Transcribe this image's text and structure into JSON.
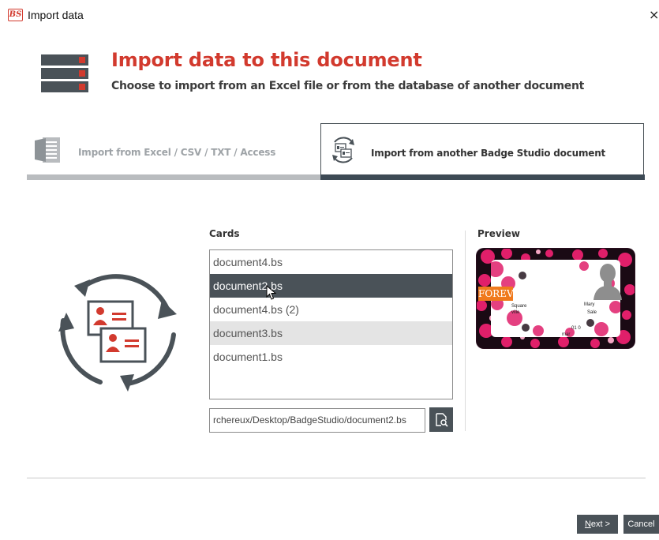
{
  "window": {
    "app_logo": "BS",
    "title": "Import data",
    "close_glyph": "×"
  },
  "header": {
    "icon": "server-stack-icon",
    "title": "Import data to this document",
    "subtitle": "Choose to import from an Excel file or from the database of another document"
  },
  "tabs": [
    {
      "label": "Import from Excel / CSV / TXT / Access",
      "icon": "excel-file-icon",
      "active": false
    },
    {
      "label": "Import from another Badge Studio document",
      "icon": "document-sync-icon",
      "active": true
    }
  ],
  "cards": {
    "label": "Cards",
    "items": [
      {
        "label": "document4.bs"
      },
      {
        "label": "document2.bs"
      },
      {
        "label": "document4.bs (2)"
      },
      {
        "label": "document3.bs"
      },
      {
        "label": "document1.bs"
      }
    ],
    "selected_index": 1,
    "path_value": "rchereux/Desktop/BadgeStudio/document2.bs",
    "browse_icon": "browse-file-icon"
  },
  "preview": {
    "label": "Preview",
    "brand": "FOREVO",
    "address_line1": "Square",
    "address_line2": "ville",
    "name_line1": "Mary",
    "name_line2": "Sale",
    "phone": "01 0",
    "email": "mar"
  },
  "buttons": {
    "next_hotkey": "N",
    "next_rest": "ext >",
    "cancel": "Cancel"
  },
  "colors": {
    "accent_red": "#d23a2e",
    "dark_slate": "#4a5258",
    "forevo_orange": "#f07a1d"
  }
}
